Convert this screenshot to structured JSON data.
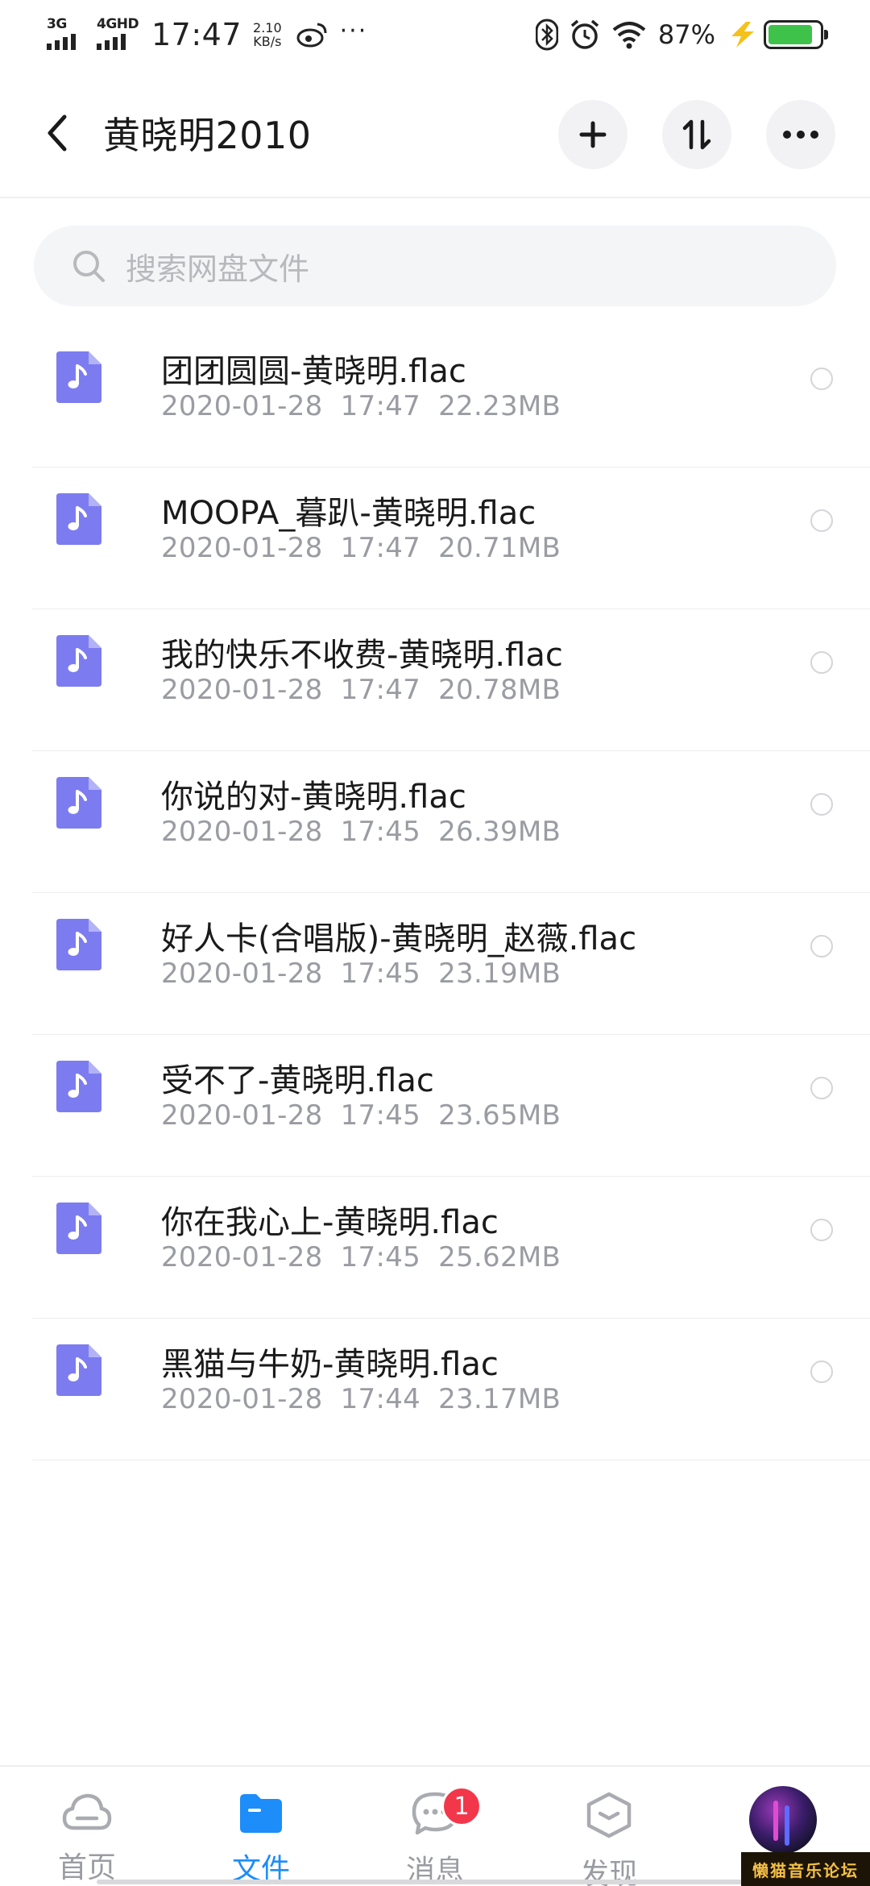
{
  "status_bar": {
    "net1": "3G",
    "net2": "4GHD",
    "time": "17:47",
    "speed_value": "2.10",
    "speed_unit": "KB/s",
    "more": "···",
    "battery_pct": "87%",
    "battery_level": 0.87,
    "icons": [
      "bluetooth-icon",
      "alarm-icon",
      "wifi-icon",
      "charging-icon"
    ]
  },
  "header": {
    "title": "黄晓明2010",
    "actions": [
      "add-icon",
      "sort-icon",
      "more-icon"
    ]
  },
  "search": {
    "placeholder": "搜索网盘文件"
  },
  "files": [
    {
      "name": "团团圆圆-黄晓明.flac",
      "date": "2020-01-28",
      "time": "17:47",
      "size": "22.23MB"
    },
    {
      "name": "MOOPA_暮趴-黄晓明.flac",
      "date": "2020-01-28",
      "time": "17:47",
      "size": "20.71MB"
    },
    {
      "name": "我的快乐不收费-黄晓明.flac",
      "date": "2020-01-28",
      "time": "17:47",
      "size": "20.78MB"
    },
    {
      "name": "你说的对-黄晓明.flac",
      "date": "2020-01-28",
      "time": "17:45",
      "size": "26.39MB"
    },
    {
      "name": "好人卡(合唱版)-黄晓明_赵薇.flac",
      "date": "2020-01-28",
      "time": "17:45",
      "size": "23.19MB"
    },
    {
      "name": "受不了-黄晓明.flac",
      "date": "2020-01-28",
      "time": "17:45",
      "size": "23.65MB"
    },
    {
      "name": "你在我心上-黄晓明.flac",
      "date": "2020-01-28",
      "time": "17:45",
      "size": "25.62MB"
    },
    {
      "name": "黑猫与牛奶-黄晓明.flac",
      "date": "2020-01-28",
      "time": "17:44",
      "size": "23.17MB"
    }
  ],
  "tabbar": {
    "tabs": [
      {
        "label": "首页",
        "icon": "cloud-icon"
      },
      {
        "label": "文件",
        "icon": "folder-icon",
        "active": true
      },
      {
        "label": "消息",
        "icon": "chat-icon",
        "badge": "1"
      },
      {
        "label": "发现",
        "icon": "discover-icon"
      }
    ],
    "watermark": "懒猫音乐论坛"
  },
  "colors": {
    "accent": "#1d8dfa",
    "file_icon": "#7c7cf0",
    "badge": "#f3374a",
    "battery": "#3ec24a"
  }
}
